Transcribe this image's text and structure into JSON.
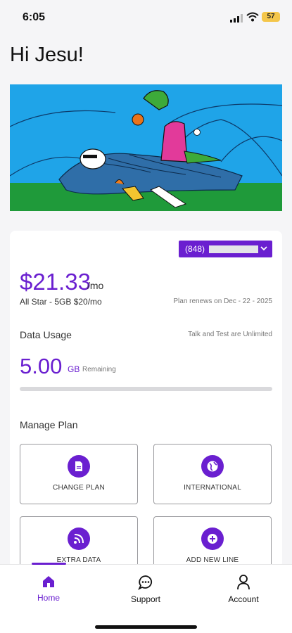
{
  "status_bar": {
    "time": "6:05",
    "battery": "57"
  },
  "greeting": "Hi Jesu!",
  "plan": {
    "phone_prefix": "(848)",
    "price": "$21.33",
    "price_unit": "/mo",
    "plan_name": "All Star - 5GB  $20/mo",
    "renews": "Plan renews on Dec - 22 - 2025"
  },
  "usage": {
    "label": "Data Usage",
    "note": "Talk and Test are Unlimited",
    "amount": "5.00",
    "unit": "GB",
    "remaining_label": "Remaining"
  },
  "manage": {
    "label": "Manage Plan",
    "tiles": [
      {
        "label": "CHANGE PLAN",
        "icon": "document-icon"
      },
      {
        "label": "INTERNATIONAL",
        "icon": "globe-icon"
      },
      {
        "label": "EXTRA DATA",
        "icon": "rss-icon"
      },
      {
        "label": "ADD NEW LINE",
        "icon": "plus-icon"
      }
    ]
  },
  "tabs": [
    {
      "label": "Home",
      "icon": "home-icon",
      "active": true
    },
    {
      "label": "Support",
      "icon": "chat-icon",
      "active": false
    },
    {
      "label": "Account",
      "icon": "person-icon",
      "active": false
    }
  ],
  "colors": {
    "accent": "#6a1fd0",
    "hero_sky": "#1fa4e8",
    "hero_grass": "#1f9a3a"
  }
}
